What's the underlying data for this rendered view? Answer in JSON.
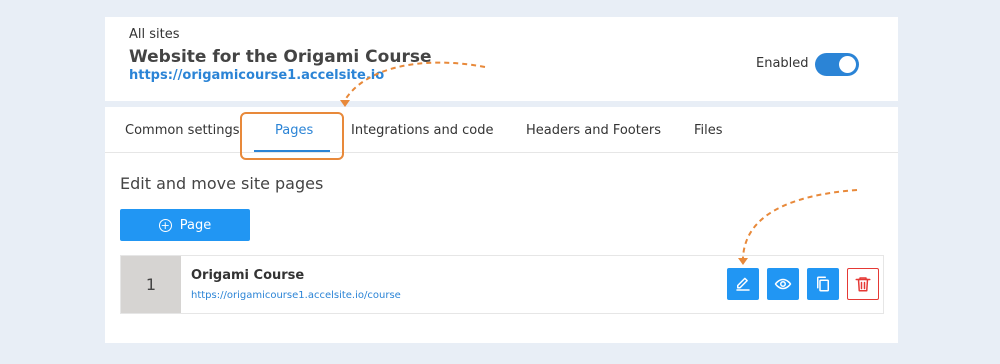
{
  "header": {
    "breadcrumb": "All sites",
    "site_title": "Website for the Origami Course",
    "site_url": "https://origamicourse1.accelsite.io",
    "enabled_label": "Enabled",
    "enabled": true
  },
  "tabs": [
    {
      "label": "Common settings",
      "active": false
    },
    {
      "label": "Pages",
      "active": true
    },
    {
      "label": "Integrations and code",
      "active": false
    },
    {
      "label": "Headers and Footers",
      "active": false
    },
    {
      "label": "Files",
      "active": false
    }
  ],
  "main": {
    "section_title": "Edit and move site pages",
    "add_page_label": "Page",
    "pages": [
      {
        "number": "1",
        "name": "Origami Course",
        "url": "https://origamicourse1.accelsite.io/course",
        "actions": [
          "edit-icon",
          "eye-icon",
          "copy-icon",
          "trash-icon"
        ]
      }
    ]
  },
  "colors": {
    "accent": "#2196f3",
    "link": "#2b84d6",
    "annotation": "#e8893a",
    "danger": "#e53935",
    "background": "#e8eef6"
  }
}
